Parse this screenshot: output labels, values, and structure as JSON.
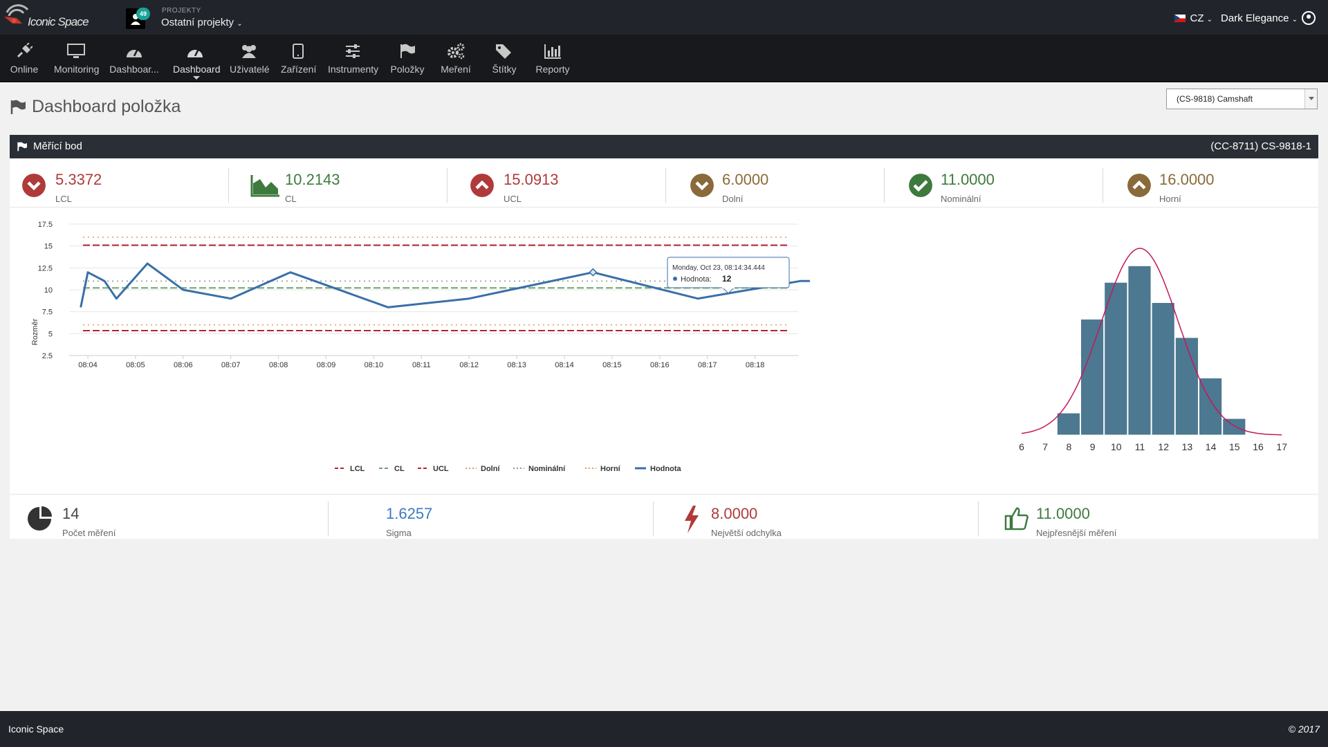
{
  "app": {
    "logo_text": "Iconic Space",
    "projects_label": "PROJEKTY",
    "projects_badge": "49",
    "project_name": "Ostatní projekty",
    "language": "CZ",
    "theme": "Dark Elegance"
  },
  "nav": [
    {
      "label": "Online",
      "icon": "plug-icon"
    },
    {
      "label": "Monitoring",
      "icon": "monitor-icon"
    },
    {
      "label": "Dashboar...",
      "icon": "gauge-icon"
    },
    {
      "label": "Dashboard",
      "icon": "gauge-icon"
    },
    {
      "label": "Uživatelé",
      "icon": "users-icon"
    },
    {
      "label": "Zařízení",
      "icon": "tablet-icon"
    },
    {
      "label": "Instrumenty",
      "icon": "sliders-icon"
    },
    {
      "label": "Položky",
      "icon": "flag-icon"
    },
    {
      "label": "Meření",
      "icon": "gears-icon"
    },
    {
      "label": "Štítky",
      "icon": "tags-icon"
    },
    {
      "label": "Reporty",
      "icon": "bar-chart-icon"
    }
  ],
  "page": {
    "title": "Dashboard položka",
    "item_select": "(CS-9818) Camshaft"
  },
  "panel": {
    "title": "Měřící bod",
    "code": "(CC-8711) CS-9818-1"
  },
  "stats": [
    {
      "value": "5.3372",
      "label": "LCL",
      "color": "#b03a3a",
      "icon": "chevron-down-circle-icon"
    },
    {
      "value": "10.2143",
      "label": "CL",
      "color": "#3e7a3e",
      "icon": "area-chart-icon"
    },
    {
      "value": "15.0913",
      "label": "UCL",
      "color": "#b03a3a",
      "icon": "chevron-up-circle-icon"
    },
    {
      "value": "6.0000",
      "label": "Dolní",
      "color": "#8a6a3a",
      "icon": "chevron-down-circle-icon"
    },
    {
      "value": "11.0000",
      "label": "Nominální",
      "color": "#3e7a3e",
      "icon": "check-circle-icon"
    },
    {
      "value": "16.0000",
      "label": "Horní",
      "color": "#8a6a3a",
      "icon": "chevron-up-circle-icon"
    }
  ],
  "chart_data": [
    {
      "type": "line",
      "ylabel": "Rozměr",
      "ylim": [
        2.5,
        17.5
      ],
      "yticks": [
        "2.5",
        "5",
        "7.5",
        "10",
        "12.5",
        "15",
        "17.5"
      ],
      "xticks": [
        "08:04",
        "08:05",
        "08:06",
        "08:07",
        "08:08",
        "08:09",
        "08:10",
        "08:11",
        "08:12",
        "08:13",
        "08:14",
        "08:15",
        "08:16",
        "08:17",
        "08:18"
      ],
      "x": [
        3.85,
        4.0,
        4.35,
        4.6,
        5.25,
        6.0,
        7.0,
        8.25,
        10.3,
        12.0,
        14.6,
        16.8,
        18.95,
        19.15
      ],
      "series": [
        {
          "name": "Hodnota",
          "color": "#3a6fa8",
          "values": [
            8,
            12,
            11,
            9,
            13,
            10,
            9,
            12,
            8,
            9,
            12,
            9,
            11,
            11
          ]
        }
      ],
      "reference_lines": [
        {
          "name": "LCL",
          "value": 5.3372,
          "color": "#b22234",
          "dash": "dashed"
        },
        {
          "name": "CL",
          "value": 10.2143,
          "color": "#6aa56a",
          "dash": "dashed"
        },
        {
          "name": "UCL",
          "value": 15.0913,
          "color": "#b22234",
          "dash": "dashed"
        },
        {
          "name": "Dolní",
          "value": 6.0,
          "color": "#e09a5a",
          "dash": "dotted"
        },
        {
          "name": "Nominální",
          "value": 11.0,
          "color": "#8a9a8a",
          "dash": "dotted"
        },
        {
          "name": "Horní",
          "value": 16.0,
          "color": "#e09a5a",
          "dash": "dotted"
        }
      ],
      "legend": [
        "LCL",
        "CL",
        "UCL",
        "Dolní",
        "Nominální",
        "Horní",
        "Hodnota"
      ],
      "legend_position": "bottom",
      "grid": true,
      "tooltip": {
        "title": "Monday, Oct 23, 08:14:34.444",
        "label": "Hodnota:",
        "value": "12"
      }
    },
    {
      "type": "bar",
      "categories": [
        "6",
        "7",
        "8",
        "9",
        "10",
        "11",
        "12",
        "13",
        "14",
        "15",
        "16",
        "17"
      ],
      "bins": [
        8,
        9,
        10,
        11,
        12,
        13,
        14,
        15
      ],
      "values": [
        0.12,
        0.63,
        0.83,
        0.92,
        0.72,
        0.53,
        0.31,
        0.09
      ],
      "curve": "normal",
      "bar_color": "#4d7891",
      "curve_color": "#c2185b"
    }
  ],
  "footer_stats": [
    {
      "value": "14",
      "label": "Počet měření",
      "color": "#444",
      "icon": "pie-chart-icon"
    },
    {
      "value": "1.6257",
      "label": "Sigma",
      "color": "#3a7abf",
      "icon": ""
    },
    {
      "value": "8.0000",
      "label": "Největší odchylka",
      "color": "#b03a3a",
      "icon": "bolt-icon"
    },
    {
      "value": "11.0000",
      "label": "Nejpřesnější měření",
      "color": "#3e7a3e",
      "icon": "thumbs-up-icon"
    }
  ],
  "footer": {
    "left": "Iconic Space",
    "right": "© 2017"
  }
}
